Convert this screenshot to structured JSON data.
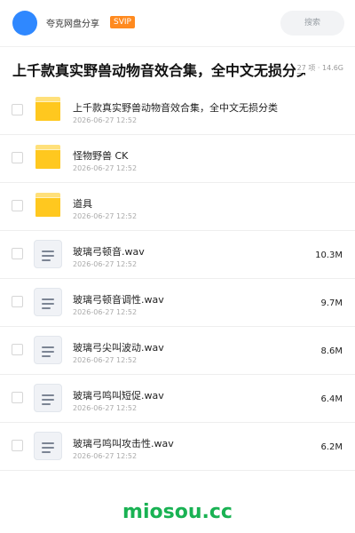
{
  "header": {
    "uploader_name": "夸克网盘分享",
    "badge": "SVIP",
    "search_placeholder": "搜索"
  },
  "title_bar": {
    "title": "上千款真实野兽动物音效合集，全中文无损分类",
    "meta": "27 项 · 14.6G"
  },
  "files": [
    {
      "type": "folder",
      "name": "上千款真实野兽动物音效合集，全中文无损分类",
      "date": "2026-06-27 12:52",
      "size": ""
    },
    {
      "type": "folder",
      "name": "怪物野兽 CK",
      "date": "2026-06-27 12:52",
      "size": ""
    },
    {
      "type": "folder",
      "name": "道具",
      "date": "2026-06-27 12:52",
      "size": ""
    },
    {
      "type": "file",
      "name": "玻璃弓顿音.wav",
      "date": "2026-06-27 12:52",
      "size": "10.3M"
    },
    {
      "type": "file",
      "name": "玻璃弓顿音调性.wav",
      "date": "2026-06-27 12:52",
      "size": "9.7M"
    },
    {
      "type": "file",
      "name": "玻璃弓尖叫波动.wav",
      "date": "2026-06-27 12:52",
      "size": "8.6M"
    },
    {
      "type": "file",
      "name": "玻璃弓鸣叫短促.wav",
      "date": "2026-06-27 12:52",
      "size": "6.4M"
    },
    {
      "type": "file",
      "name": "玻璃弓鸣叫攻击性.wav",
      "date": "2026-06-27 12:52",
      "size": "6.2M"
    }
  ],
  "footer": {
    "watermark": "miosou.cc"
  },
  "colors": {
    "avatar": "#2f88ff",
    "badge": "#ff8a1f",
    "folder": "#ffc81f",
    "watermark": "#19b253"
  },
  "icons": {
    "folder": "folder-icon",
    "file": "audio-file-icon"
  }
}
